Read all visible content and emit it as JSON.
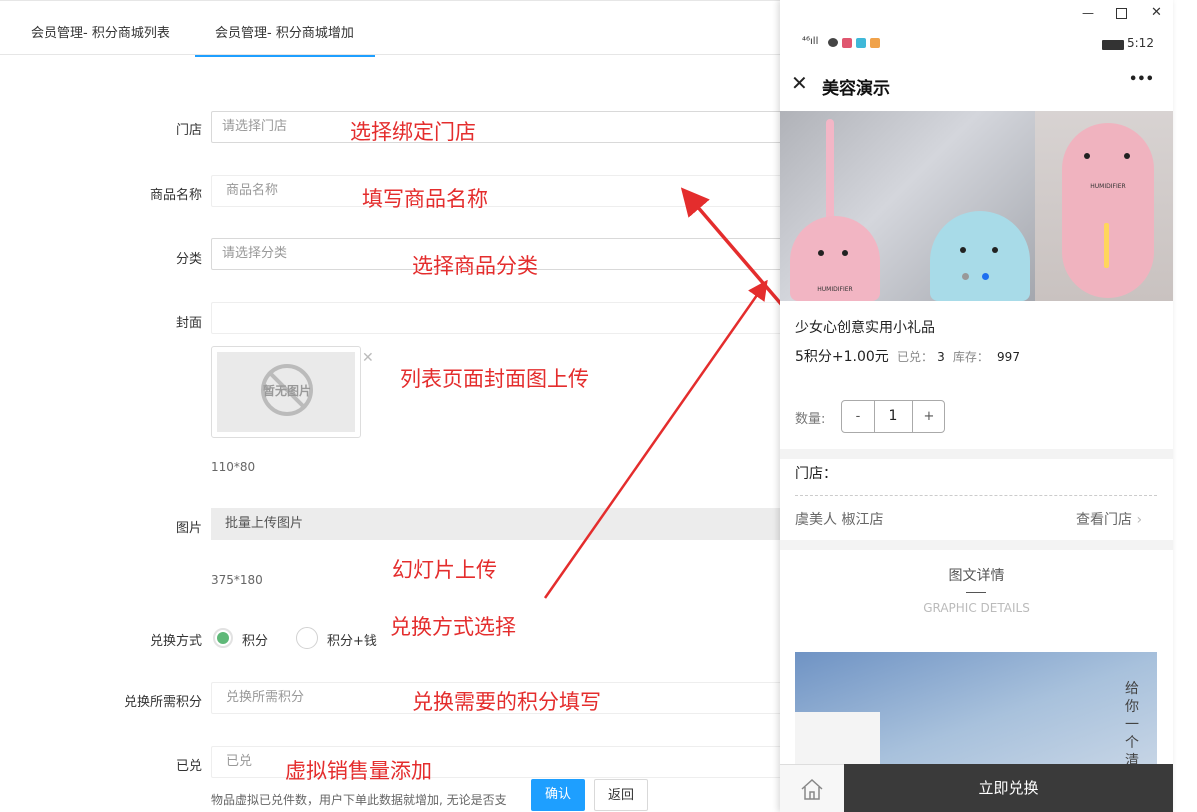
{
  "tabs": [
    {
      "label": "会员管理- 积分商城列表",
      "active": false
    },
    {
      "label": "会员管理- 积分商城增加",
      "active": true
    }
  ],
  "form": {
    "store": {
      "label": "门店",
      "placeholder": "请选择门店"
    },
    "name": {
      "label": "商品名称",
      "placeholder": "商品名称"
    },
    "category": {
      "label": "分类",
      "placeholder": "请选择分类"
    },
    "cover": {
      "label": "封面",
      "value": "",
      "thumb_text": "暂无图片",
      "size_hint": "110*80"
    },
    "images": {
      "label": "图片",
      "button": "批量上传图片",
      "size_hint": "375*180"
    },
    "exchange": {
      "label": "兑换方式",
      "options": [
        "积分",
        "积分+钱"
      ],
      "selected": "积分"
    },
    "points": {
      "label": "兑换所需积分",
      "placeholder": "兑换所需积分"
    },
    "sold": {
      "label": "已兑",
      "placeholder": "已兑",
      "hint": "物品虚拟已兑件数，用户下单此数据就增加, 无论是否支"
    },
    "confirm": "确认",
    "back": "返回"
  },
  "annotations": {
    "store": "选择绑定门店",
    "name": "填写商品名称",
    "category": "选择商品分类",
    "cover": "列表页面封面图上传",
    "slides": "幻灯片上传",
    "exchange": "兑换方式选择",
    "points": "兑换需要的积分填写",
    "sold": "虚拟销售量添加"
  },
  "colors": {
    "annotation": "#e42d2d",
    "accent": "#1e9fff",
    "confirm": "#1e9fff",
    "radio_on": "#5fb878",
    "footer_dark": "#3a3a3a"
  },
  "phone": {
    "window_controls": [
      "minimize",
      "maximize",
      "close"
    ],
    "status": {
      "left": "⁴⁶ıll",
      "time": "5:12"
    },
    "nav": {
      "title": "美容演示",
      "more": "•••"
    },
    "banner": {
      "brand": "HUMIDIFIER",
      "dots": 2,
      "active_dot": 2
    },
    "product": {
      "title": "少女心创意实用小礼品",
      "price": "5积分+1.00元",
      "sold_label": "已兑：",
      "sold": "3",
      "stock_label": "库存：",
      "stock": "997"
    },
    "qty": {
      "label": "数量:",
      "minus": "-",
      "value": "1",
      "plus": "+"
    },
    "store": {
      "label": "门店：",
      "name": "虞美人 椒江店",
      "link": "查看门店"
    },
    "details": {
      "title": "图文详情",
      "subtitle": "GRAPHIC DETAILS",
      "img_text": "给你一个清"
    },
    "footer": {
      "home_icon": "home-icon",
      "action": "立即兑换"
    }
  }
}
